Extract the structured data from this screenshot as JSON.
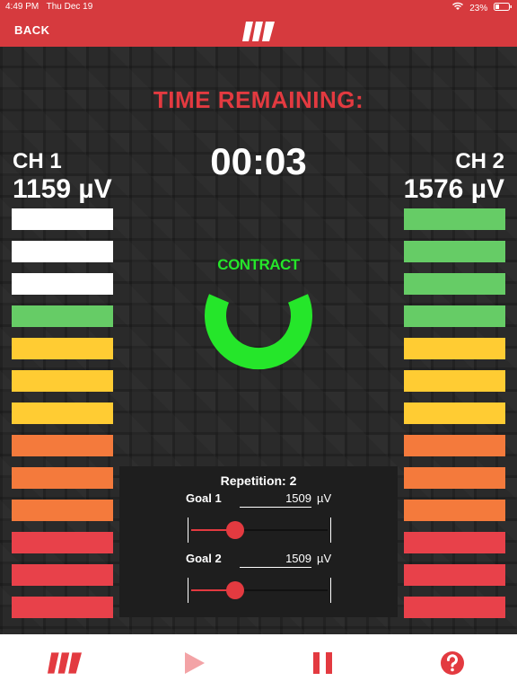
{
  "status_bar": {
    "time": "4:49 PM",
    "date": "Thu Dec 19",
    "battery": "23%"
  },
  "nav": {
    "back_label": "BACK",
    "logo_icon": "m-logo-icon"
  },
  "session": {
    "time_remaining_label": "TIME REMAINING:",
    "timer": "00:03",
    "state_label": "CONTRACT"
  },
  "channels": {
    "ch1": {
      "name": "CH 1",
      "value": "1159 µV"
    },
    "ch2": {
      "name": "CH 2",
      "value": "1576 µV"
    }
  },
  "colors": {
    "accent": "#e33a40",
    "white": "#ffffff",
    "green": "#66cc66",
    "yellow": "#ffcc33",
    "orange": "#f47a3c",
    "red": "#e8414a",
    "contract": "#25e62a"
  },
  "bar_levels": {
    "ch1": [
      "white",
      "white",
      "white",
      "green",
      "yellow",
      "yellow",
      "yellow",
      "orange",
      "orange",
      "orange",
      "red",
      "red",
      "red"
    ],
    "ch2": [
      "green",
      "green",
      "green",
      "green",
      "yellow",
      "yellow",
      "yellow",
      "orange",
      "orange",
      "orange",
      "red",
      "red",
      "red"
    ]
  },
  "goals": {
    "repetition_label": "Repetition: 2",
    "goal1": {
      "label": "Goal 1",
      "value": "1509",
      "unit": "µV",
      "slider_fraction": 0.32
    },
    "goal2": {
      "label": "Goal 2",
      "value": "1509",
      "unit": "µV",
      "slider_fraction": 0.32
    }
  },
  "toolbar": {
    "items": [
      "m-logo-icon",
      "play-icon",
      "pause-icon",
      "help-icon"
    ]
  }
}
